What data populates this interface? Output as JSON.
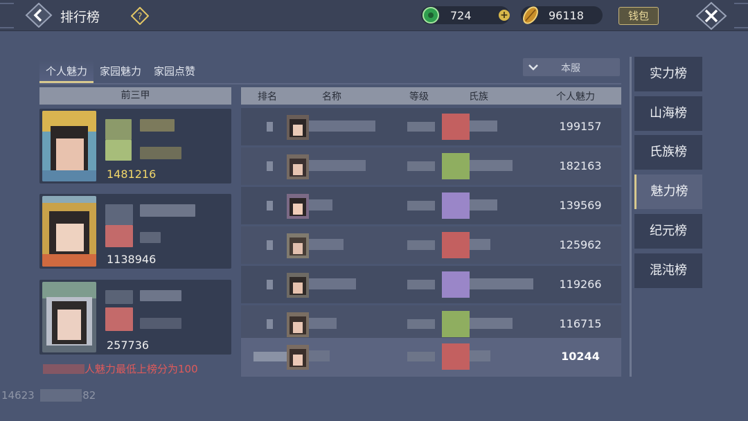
{
  "header": {
    "title": "排行榜",
    "currency": [
      {
        "icon": "jade-icon",
        "value": "724",
        "color": "#3cb55a"
      },
      {
        "icon": "gold-seed-icon",
        "value": "96118",
        "color": "#d4a030"
      }
    ],
    "wallet_label": "钱包"
  },
  "tabs": [
    {
      "label": "个人魅力",
      "active": true
    },
    {
      "label": "家园魅力",
      "active": false
    },
    {
      "label": "家园点赞",
      "active": false
    }
  ],
  "server_filter": {
    "selected": "本服"
  },
  "top3": {
    "header": "前三甲",
    "entries": [
      {
        "score": "1481216"
      },
      {
        "score": "1138946"
      },
      {
        "score": "257736"
      }
    ],
    "note": "人魅力最低上榜分为100"
  },
  "table": {
    "columns": [
      "排名",
      "名称",
      "等级",
      "氏族",
      "个人魅力"
    ],
    "rows": [
      {
        "score": "199157",
        "clan_color": "#c36060"
      },
      {
        "score": "182163",
        "clan_color": "#8fae60"
      },
      {
        "score": "139569",
        "clan_color": "#9a86c8"
      },
      {
        "score": "125962",
        "clan_color": "#c36060"
      },
      {
        "score": "119266",
        "clan_color": "#9a86c8"
      },
      {
        "score": "116715",
        "clan_color": "#8fae60"
      }
    ],
    "self_row": {
      "score": "10244",
      "clan_color": "#c36060"
    }
  },
  "boards": [
    {
      "label": "实力榜",
      "active": false
    },
    {
      "label": "山海榜",
      "active": false
    },
    {
      "label": "氏族榜",
      "active": false
    },
    {
      "label": "魅力榜",
      "active": true
    },
    {
      "label": "纪元榜",
      "active": false
    },
    {
      "label": "混沌榜",
      "active": false
    }
  ],
  "footer": {
    "uid": "14623",
    "uid_tail": "682"
  },
  "colors": {
    "accent": "#d8c98f",
    "highlight_score": "#f3d86a",
    "warning": "#e05a5a"
  }
}
